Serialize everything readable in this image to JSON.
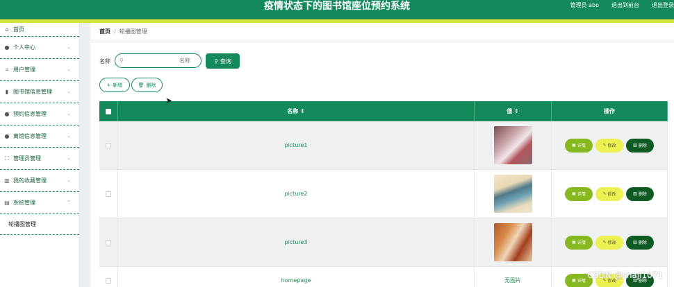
{
  "header": {
    "title": "疫情状态下的图书馆座位预约系统",
    "user_label": "管理员 abo",
    "to_frontend": "退出到前台",
    "logout": "退出登录"
  },
  "sidebar": {
    "items": [
      {
        "label": "首页",
        "icon": "home-icon"
      },
      {
        "label": "个人中心",
        "icon": "person-icon"
      },
      {
        "label": "用户管理",
        "icon": "crop-icon"
      },
      {
        "label": "图书馆信息管理",
        "icon": "bar-chart-icon"
      },
      {
        "label": "预约信息管理",
        "icon": "location-icon"
      },
      {
        "label": "离馆信息管理",
        "icon": "person-icon"
      },
      {
        "label": "管理员管理",
        "icon": "fullscreen-icon"
      },
      {
        "label": "我的收藏管理",
        "icon": "bookshelf-icon"
      },
      {
        "label": "系统管理",
        "icon": "document-icon"
      }
    ],
    "submenu": "轮播图管理"
  },
  "breadcrumb": {
    "home": "首页",
    "sep": "/",
    "current": "轮播图管理"
  },
  "search": {
    "label": "名称",
    "placeholder": "名称",
    "query_label": "查询"
  },
  "actions": {
    "add_label": "新增",
    "delete_label": "删除"
  },
  "table": {
    "headers": {
      "name": "名称",
      "image": "值",
      "ops": "操作"
    },
    "rows": [
      {
        "name": "picture1",
        "image_note": ""
      },
      {
        "name": "picture2",
        "image_note": ""
      },
      {
        "name": "picture3",
        "image_note": ""
      },
      {
        "name": "homepage",
        "image_note": "无图片"
      }
    ],
    "op_labels": {
      "detail": "详情",
      "edit": "修改",
      "delete": "删除"
    }
  },
  "watermark": "CSDN @shaji1071",
  "colors": {
    "primary": "#148a5c",
    "accent": "#d7e23a",
    "detail": "#88b820",
    "edit": "#ecf152",
    "delete": "#0e5c24"
  }
}
